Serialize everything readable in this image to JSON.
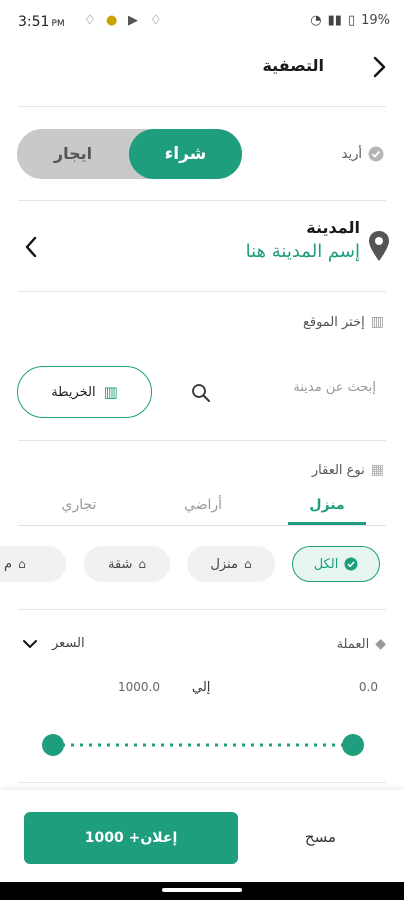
{
  "status_bar": {
    "time": "3:51",
    "ampm": "PM",
    "battery": "19%"
  },
  "header": {
    "title": "التصفية"
  },
  "intent": {
    "label": "أريد",
    "options": [
      "شراء",
      "ايجار"
    ],
    "selected": "شراء"
  },
  "city": {
    "label": "المدينة",
    "placeholder": "إسم المدينة هنا"
  },
  "location": {
    "label": "إختر الموقع",
    "search_placeholder": "إبحث عن مدينة",
    "map_button": "الخريطة"
  },
  "property_type": {
    "label": "نوع العقار",
    "tabs": [
      "منزل",
      "أراضي",
      "تجاري"
    ],
    "active_tab": "منزل",
    "chips": [
      "الكل",
      "منزل",
      "شقة",
      "م"
    ],
    "selected_chip": "الكل"
  },
  "price": {
    "currency_label": "العملة",
    "price_label": "السعر",
    "min": "0.0",
    "to_label": "إلي",
    "max": "1000.0",
    "range_fraction": [
      0,
      1
    ]
  },
  "footer": {
    "clear": "مسح",
    "results_button": "إعلان+ 1000"
  },
  "colors": {
    "accent": "#1e9e7c",
    "toggle_off": "#c9c9c9"
  }
}
